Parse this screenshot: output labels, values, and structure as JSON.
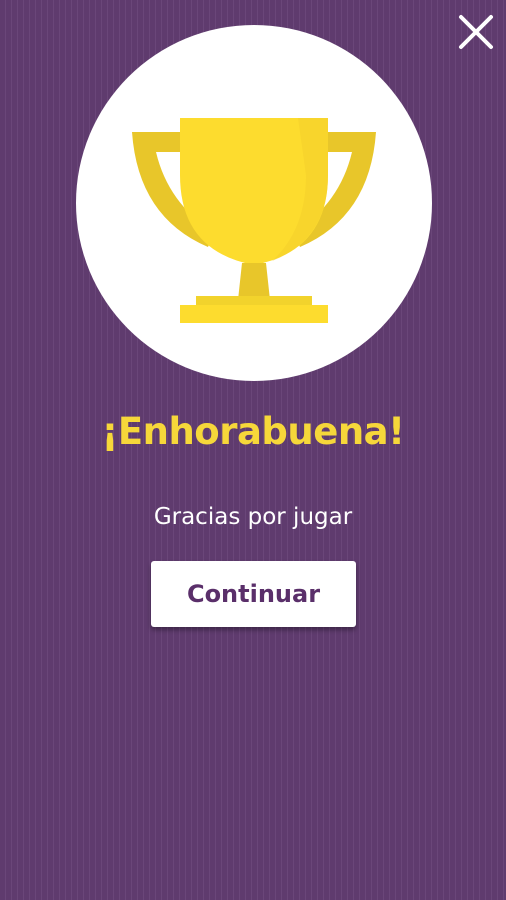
{
  "header": {
    "close_icon": "close-icon"
  },
  "hero": {
    "trophy_icon": "trophy-icon"
  },
  "message": {
    "title": "¡Enhorabuena!",
    "subtitle": "Gracias por jugar"
  },
  "actions": {
    "continue_label": "Continuar"
  },
  "colors": {
    "background": "#5f3b6e",
    "title": "#f6d73a",
    "button_text": "#5a2f6a",
    "trophy_primary": "#fddc2e",
    "trophy_shadow": "#e8c62a"
  }
}
